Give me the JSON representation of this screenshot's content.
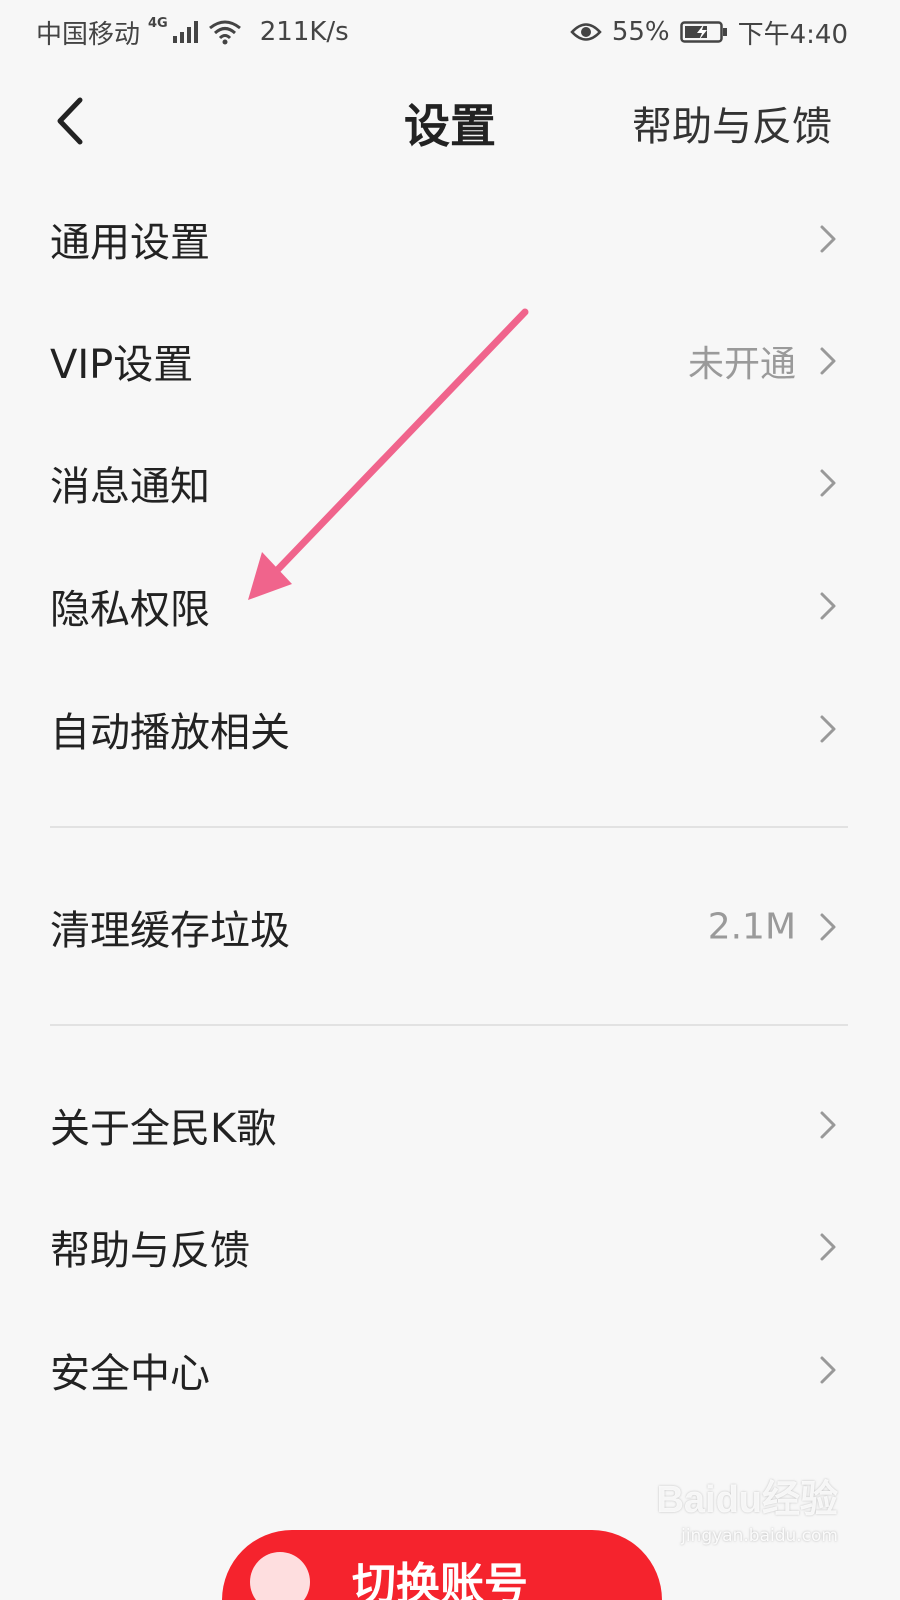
{
  "status_bar": {
    "carrier": "中国移动",
    "network": "4G",
    "speed": "211K/s",
    "battery": "55%",
    "time": "下午4:40"
  },
  "header": {
    "title": "设置",
    "help_label": "帮助与反馈",
    "back_icon": "chevron-left-icon"
  },
  "settings": {
    "group1": [
      {
        "label": "通用设置",
        "value": ""
      },
      {
        "label": "VIP设置",
        "value": "未开通"
      },
      {
        "label": "消息通知",
        "value": ""
      },
      {
        "label": "隐私权限",
        "value": ""
      },
      {
        "label": "自动播放相关",
        "value": ""
      }
    ],
    "group2": [
      {
        "label": "清理缓存垃圾",
        "value": "2.1M"
      }
    ],
    "group3": [
      {
        "label": "关于全民K歌",
        "value": ""
      },
      {
        "label": "帮助与反馈",
        "value": ""
      },
      {
        "label": "安全中心",
        "value": ""
      }
    ]
  },
  "bottom_button": {
    "label": "切换账号"
  },
  "watermark": {
    "brand": "Baidu经验",
    "url": "jingyan.baidu.com"
  },
  "colors": {
    "background": "#f7f7f7",
    "primary_red": "#f5232d",
    "annotation_arrow": "#f0648c",
    "secondary_text": "#9a9a9a"
  }
}
